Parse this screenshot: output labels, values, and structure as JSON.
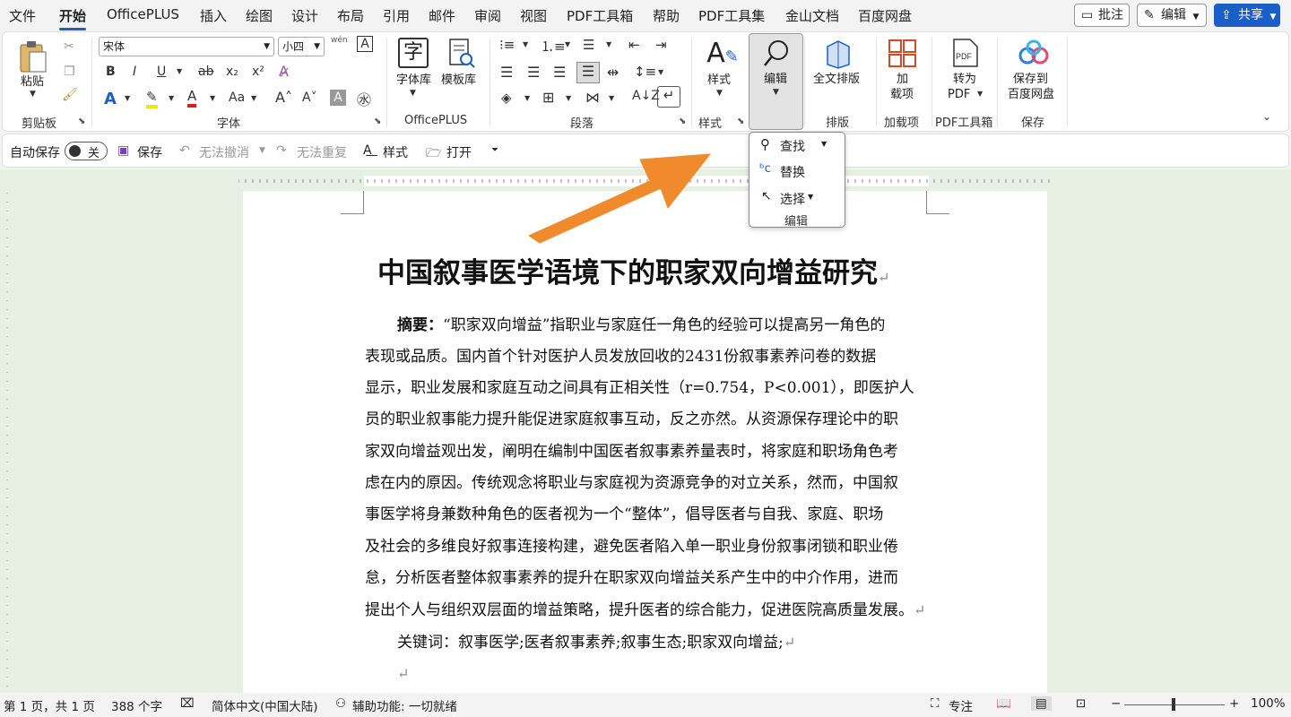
{
  "menubar": {
    "items": [
      "文件",
      "开始",
      "OfficePLUS",
      "插入",
      "绘图",
      "设计",
      "布局",
      "引用",
      "邮件",
      "审阅",
      "视图",
      "PDF工具箱",
      "帮助",
      "PDF工具集",
      "金山文档",
      "百度网盘"
    ],
    "comment_btn": "批注",
    "edit_btn": "编辑",
    "share_btn": "共享"
  },
  "ribbon": {
    "paste": "粘贴",
    "clipboard_group": "剪贴板",
    "font_name": "宋体",
    "font_size": "小四",
    "phonetic": "wén",
    "font_group": "字体",
    "font_lib": "字体库",
    "template_lib": "模板库",
    "officeplus_group": "OfficePLUS",
    "paragraph_group": "段落",
    "styles_btn": "样式",
    "styles_group": "样式",
    "edit_btn": "编辑",
    "fulltext_btn": "全文排版",
    "layout_group": "排版",
    "addin_btn_1": "加",
    "addin_btn_2": "载项",
    "addin_group": "加载项",
    "topdf_btn_1": "转为",
    "topdf_btn_2": "PDF",
    "pdf_group": "PDF工具箱",
    "baidu_btn_1": "保存到",
    "baidu_btn_2": "百度网盘",
    "save_group": "保存"
  },
  "qat": {
    "autosave": "自动保存",
    "toggle_state": "关",
    "save": "保存",
    "undo": "无法撤消",
    "redo": "无法重复",
    "styles": "样式",
    "open": "打开"
  },
  "popup": {
    "find": "查找",
    "replace": "替换",
    "select": "选择",
    "group": "编辑"
  },
  "document": {
    "title": "中国叙事医学语境下的职家双向增益研究",
    "abstract_label": "摘要：",
    "lines": [
      "“职家双向增益”指职业与家庭任一角色的经验可以提高另一角色的",
      "表现或品质。国内首个针对医护人员发放回收的2431份叙事素养问卷的数据",
      "显示，职业发展和家庭互动之间具有正相关性（r=0.754，P<0.001），即医护人",
      "员的职业叙事能力提升能促进家庭叙事互动，反之亦然。从资源保存理论中的职",
      "家双向增益观出发，阐明在编制中国医者叙事素养量表时，将家庭和职场角色考",
      "虑在内的原因。传统观念将职业与家庭视为资源竞争的对立关系，然而，中国叙",
      "事医学将身兼数种角色的医者视为一个“整体”，倡导医者与自我、家庭、职场",
      "及社会的多维良好叙事连接构建，避免医者陷入单一职业身份叙事闭锁和职业倦",
      "怠，分析医者整体叙事素养的提升在职家双向增益关系产生中的中介作用，进而",
      "提出个人与组织双层面的增益策略，提升医者的综合能力，促进医院高质量发展。"
    ],
    "keywords_label": "关键词：",
    "keywords": "叙事医学;医者叙事素养;叙事生态;职家双向增益;"
  },
  "status": {
    "page": "第 1 页，共 1 页",
    "words": "388 个字",
    "language": "简体中文(中国大陆)",
    "accessibility": "辅助功能: 一切就绪",
    "focus": "专注",
    "zoom": "100%"
  },
  "colors": {
    "accent": "#1a5fc8",
    "arrow": "#f08a2c",
    "doc_bg": "#e6f0e3"
  }
}
